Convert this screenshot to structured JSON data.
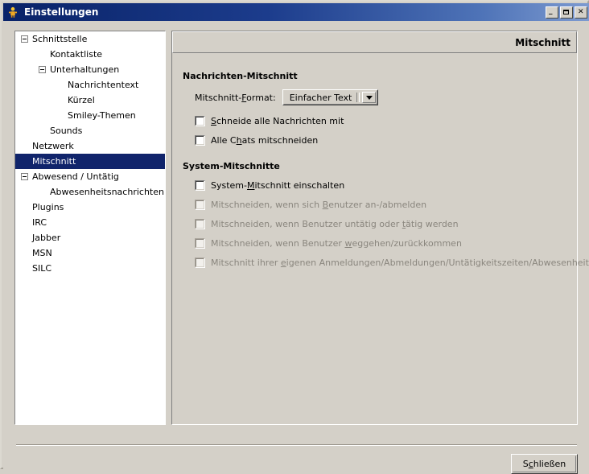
{
  "window": {
    "title": "Einstellungen",
    "icon": "buddy-person-icon",
    "controls": {
      "minimize": "_",
      "maximize": "□",
      "close": "✕"
    }
  },
  "sidebar": {
    "items": [
      {
        "label": "Schnittstelle",
        "indent": 0,
        "expander": "minus",
        "selected": false
      },
      {
        "label": "Kontaktliste",
        "indent": 1,
        "expander": "none",
        "selected": false
      },
      {
        "label": "Unterhaltungen",
        "indent": 1,
        "expander": "minus",
        "selected": false
      },
      {
        "label": "Nachrichtentext",
        "indent": 2,
        "expander": "none",
        "selected": false
      },
      {
        "label": "Kürzel",
        "indent": 2,
        "expander": "none",
        "selected": false
      },
      {
        "label": "Smiley-Themen",
        "indent": 2,
        "expander": "none",
        "selected": false
      },
      {
        "label": "Sounds",
        "indent": 1,
        "expander": "none",
        "selected": false
      },
      {
        "label": "Netzwerk",
        "indent": 0,
        "expander": "none",
        "selected": false
      },
      {
        "label": "Mitschnitt",
        "indent": 0,
        "expander": "none",
        "selected": true
      },
      {
        "label": "Abwesend / Untätig",
        "indent": 0,
        "expander": "minus",
        "selected": false
      },
      {
        "label": "Abwesenheitsnachrichten",
        "indent": 1,
        "expander": "none",
        "selected": false
      },
      {
        "label": "Plugins",
        "indent": 0,
        "expander": "none",
        "selected": false
      },
      {
        "label": "IRC",
        "indent": 0,
        "expander": "none",
        "selected": false
      },
      {
        "label": "Jabber",
        "indent": 0,
        "expander": "none",
        "selected": false
      },
      {
        "label": "MSN",
        "indent": 0,
        "expander": "none",
        "selected": false
      },
      {
        "label": "SILC",
        "indent": 0,
        "expander": "none",
        "selected": false
      }
    ]
  },
  "panel": {
    "header_title": "Mitschnitt",
    "sections": [
      {
        "title": "Nachrichten-Mitschnitt",
        "format_label_pre": "Mitschnitt-",
        "format_label_mnemonic": "F",
        "format_label_post": "ormat:",
        "format_value": "Einfacher Text",
        "format_options": [
          "Einfacher Text"
        ],
        "checkboxes": [
          {
            "pre": "",
            "mnemonic": "S",
            "post": "chneide alle Nachrichten mit",
            "checked": false,
            "disabled": false
          },
          {
            "pre": "Alle C",
            "mnemonic": "h",
            "post": "ats mitschneiden",
            "checked": false,
            "disabled": false
          }
        ]
      },
      {
        "title": "System-Mitschnitte",
        "checkboxes": [
          {
            "pre": "System-",
            "mnemonic": "M",
            "post": "itschnitt einschalten",
            "checked": false,
            "disabled": false
          },
          {
            "pre": "Mitschneiden, wenn sich ",
            "mnemonic": "B",
            "post": "enutzer an-/abmelden",
            "checked": false,
            "disabled": true
          },
          {
            "pre": "Mitschneiden, wenn Benutzer untätig oder ",
            "mnemonic": "t",
            "post": "ätig werden",
            "checked": false,
            "disabled": true
          },
          {
            "pre": "Mitschneiden, wenn Benutzer ",
            "mnemonic": "w",
            "post": "eggehen/zurückkommen",
            "checked": false,
            "disabled": true
          },
          {
            "pre": "Mitschnitt ihrer ",
            "mnemonic": "e",
            "post": "igenen Anmeldungen/Abmeldungen/Untätigkeitszeiten/Abwesenheitszeiten",
            "checked": false,
            "disabled": true
          }
        ]
      }
    ]
  },
  "footer": {
    "close_pre": "S",
    "close_mnemonic": "c",
    "close_post": "hließen"
  },
  "colors": {
    "titlebar_start": "#0a246a",
    "titlebar_end": "#7d9ad0",
    "face": "#d4d0c8",
    "selection": "#10246b",
    "disabled_text": "#8a867e",
    "tree_bg": "#ffffff"
  }
}
